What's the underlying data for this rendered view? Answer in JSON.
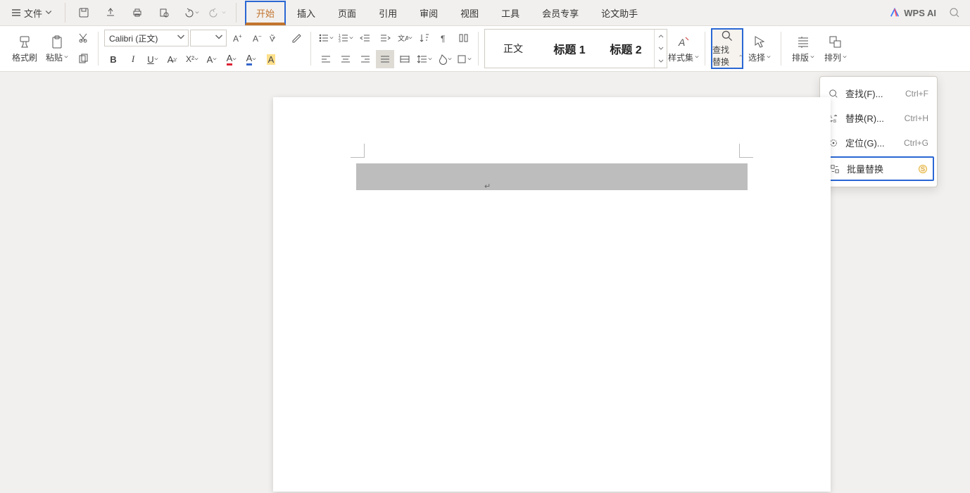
{
  "menu": {
    "file_label": "文件",
    "tabs": [
      "开始",
      "插入",
      "页面",
      "引用",
      "审阅",
      "视图",
      "工具",
      "会员专享",
      "论文助手"
    ],
    "active_tab_index": 0,
    "ai_label": "WPS AI"
  },
  "qat_icons": [
    "save-icon",
    "export-icon",
    "print-icon",
    "print-preview-icon",
    "undo-icon",
    "redo-icon"
  ],
  "ribbon": {
    "format_painter": "格式刷",
    "paste": "粘贴",
    "font_name": "Calibri (正文)",
    "font_size": "",
    "style_set": "样式集",
    "find_replace": "查找替换",
    "select": "选择",
    "layout": "排版",
    "arrange": "排列",
    "styles": {
      "normal": "正文",
      "heading1": "标题 1",
      "heading2": "标题 2"
    }
  },
  "find_menu": {
    "find": {
      "label": "查找(F)...",
      "shortcut": "Ctrl+F"
    },
    "replace": {
      "label": "替换(R)...",
      "shortcut": "Ctrl+H"
    },
    "goto": {
      "label": "定位(G)...",
      "shortcut": "Ctrl+G"
    },
    "batch": {
      "label": "批量替换"
    }
  },
  "icons": {
    "hamburger": "hamburger-icon",
    "save": "save-icon",
    "export": "export-icon",
    "print": "print-icon",
    "preview": "print-preview-icon",
    "undo": "undo-icon",
    "redo": "redo-icon",
    "search": "search-icon",
    "paintbrush": "paintbrush-icon",
    "clipboard": "clipboard-icon",
    "scissors": "scissors-icon",
    "copy": "copy-icon",
    "magnifier": "magnifier-icon",
    "cursor": "cursor-icon",
    "lines": "layout-icon",
    "shapes": "arrange-icon"
  }
}
